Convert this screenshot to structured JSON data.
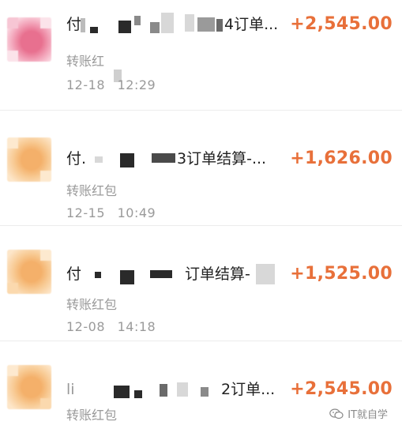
{
  "transactions": [
    {
      "title_lead": "付",
      "title_tail": "4订单...",
      "amount": "+2,545.00",
      "type": "转账红",
      "date": "12-18",
      "time": "12:29",
      "avatar_color": "#e8708f"
    },
    {
      "title_lead": "付.",
      "title_tail": "3订单结算-...",
      "amount": "+1,626.00",
      "type": "转账红包",
      "date": "12-15",
      "time": "10:49",
      "avatar_color": "#f4b06a"
    },
    {
      "title_lead": "付",
      "title_tail": "订单结算-",
      "amount": "+1,525.00",
      "type": "转账红包",
      "date": "12-08",
      "time": "14:18",
      "avatar_color": "#f4b06a"
    },
    {
      "title_lead": "li",
      "title_tail": "2订单...",
      "amount": "+2,545.00",
      "type": "转账红包",
      "date": "",
      "time": "",
      "avatar_color": "#f4b06a"
    }
  ],
  "watermark": {
    "icon": "wechat-official-account-icon",
    "text": "IT就自学"
  }
}
